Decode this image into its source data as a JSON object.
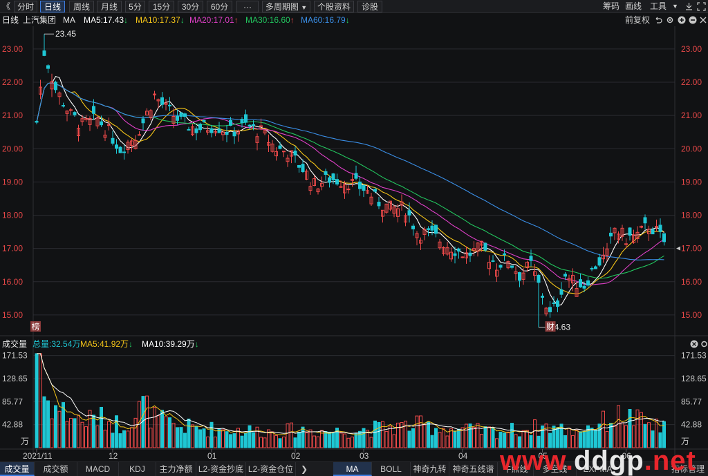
{
  "toolbar": {
    "back_glyph": "《",
    "periods": [
      "分时",
      "日线",
      "周线",
      "月线",
      "5分",
      "15分",
      "30分",
      "60分",
      "···",
      "多周期图",
      "个股资料",
      "诊股"
    ],
    "active_period": "日线",
    "right": [
      "筹码",
      "画线",
      "工具"
    ]
  },
  "ma_row": {
    "period": "日线",
    "stock": "上汽集团",
    "indicator": "MA",
    "ma5": "MA5:17.43",
    "ma10": "MA10:17.37",
    "ma20": "MA20:17.01",
    "ma30": "MA30:16.60",
    "ma60": "MA60:16.79",
    "adjust": "前复权"
  },
  "colors": {
    "up": "#f04a4a",
    "down": "#1fc7d4",
    "ma5": "#ffffff",
    "ma10": "#f5c518",
    "ma20": "#e040c8",
    "ma30": "#22c55e",
    "ma60": "#3a8ee6",
    "axis_text": "#e84848",
    "grid": "#2a2b30"
  },
  "price_axis": {
    "ticks": [
      "23.00",
      "22.00",
      "21.00",
      "20.00",
      "19.00",
      "18.00",
      "17.00",
      "16.00",
      "15.00"
    ],
    "current": "17.00"
  },
  "annotations": {
    "high": "23.45",
    "low": "14.63",
    "badge_left": "榜",
    "badge_right": "财"
  },
  "volume": {
    "title": "成交量",
    "total": "总量:32.54万",
    "ma5": "MA5:41.92万",
    "ma10": "MA10:39.29万",
    "ticks": [
      "171.53",
      "128.65",
      "85.77",
      "42.88"
    ],
    "unit": "万"
  },
  "x_axis": {
    "labels": [
      "2021/11",
      "12",
      "01",
      "02",
      "03",
      "04",
      "05",
      "06"
    ]
  },
  "tabs_left": [
    "成交量",
    "成交额",
    "MACD",
    "KDJ",
    "主力净额",
    "L2-资金抄底",
    "L2-资金仓位"
  ],
  "tabs_right": [
    "MA",
    "BOLL",
    "神奇九转",
    "神奇五线谱",
    "牛熊线",
    "多空线",
    "EXPMA",
    "指标管理"
  ],
  "watermark": "www.ddgp.net",
  "chart_data": {
    "type": "candlestick",
    "ylim": [
      14.5,
      23.6
    ],
    "vol_ylim": [
      0,
      180
    ],
    "months": [
      "2021/11",
      "12",
      "01",
      "02",
      "03",
      "04",
      "05",
      "06"
    ],
    "anchors": [
      [
        0,
        20.8
      ],
      [
        2,
        22.9
      ],
      [
        5,
        21.8
      ],
      [
        9,
        21.0
      ],
      [
        12,
        20.7
      ],
      [
        16,
        20.9
      ],
      [
        19,
        20.5
      ],
      [
        22,
        20.0
      ],
      [
        26,
        20.4
      ],
      [
        28,
        20.8
      ],
      [
        31,
        21.6
      ],
      [
        34,
        21.2
      ],
      [
        38,
        20.8
      ],
      [
        42,
        20.6
      ],
      [
        47,
        20.7
      ],
      [
        51,
        20.5
      ],
      [
        55,
        20.7
      ],
      [
        59,
        20.5
      ],
      [
        63,
        20.0
      ],
      [
        66,
        19.9
      ],
      [
        70,
        19.4
      ],
      [
        73,
        18.9
      ],
      [
        77,
        19.1
      ],
      [
        82,
        19.0
      ],
      [
        86,
        18.8
      ],
      [
        90,
        18.4
      ],
      [
        93,
        18.2
      ],
      [
        97,
        18.2
      ],
      [
        100,
        17.5
      ],
      [
        104,
        17.4
      ],
      [
        108,
        17.1
      ],
      [
        113,
        16.8
      ],
      [
        117,
        17.0
      ],
      [
        121,
        16.5
      ],
      [
        124,
        16.7
      ],
      [
        127,
        16.2
      ],
      [
        130,
        16.5
      ],
      [
        133,
        15.6
      ],
      [
        135,
        15.0
      ],
      [
        137,
        15.4
      ],
      [
        139,
        16.2
      ],
      [
        141,
        16.0
      ],
      [
        144,
        15.9
      ],
      [
        147,
        16.5
      ],
      [
        150,
        16.8
      ],
      [
        152,
        17.6
      ],
      [
        155,
        17.3
      ],
      [
        158,
        17.4
      ],
      [
        161,
        17.7
      ],
      [
        163,
        17.5
      ],
      [
        165,
        17.2
      ]
    ],
    "volume_profile": [
      [
        0,
        175
      ],
      [
        2,
        95
      ],
      [
        5,
        75
      ],
      [
        9,
        60
      ],
      [
        12,
        50
      ],
      [
        16,
        55
      ],
      [
        19,
        50
      ],
      [
        22,
        42
      ],
      [
        26,
        60
      ],
      [
        28,
        80
      ],
      [
        31,
        55
      ],
      [
        36,
        40
      ],
      [
        45,
        35
      ],
      [
        55,
        32
      ],
      [
        62,
        30
      ],
      [
        70,
        33
      ],
      [
        80,
        30
      ],
      [
        90,
        36
      ],
      [
        100,
        42
      ],
      [
        110,
        34
      ],
      [
        120,
        30
      ],
      [
        128,
        34
      ],
      [
        135,
        40
      ],
      [
        140,
        30
      ],
      [
        148,
        45
      ],
      [
        154,
        60
      ],
      [
        158,
        50
      ],
      [
        162,
        40
      ],
      [
        165,
        35
      ]
    ]
  }
}
